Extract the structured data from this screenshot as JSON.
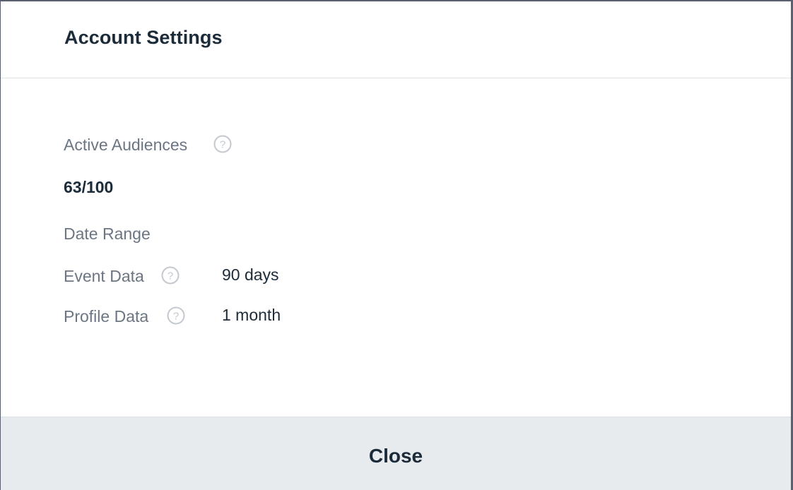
{
  "modal": {
    "title": "Account Settings"
  },
  "active_audiences": {
    "label": "Active Audiences",
    "value": "63/100",
    "icon": "help-circle-icon"
  },
  "date_range": {
    "heading": "Date Range",
    "rows": [
      {
        "label": "Event Data",
        "value": "90 days",
        "icon": "help-circle-icon"
      },
      {
        "label": "Profile Data",
        "value": "1 month",
        "icon": "help-circle-icon"
      }
    ]
  },
  "footer": {
    "close_label": "Close"
  },
  "colors": {
    "title_text": "#1c2b3a",
    "label_text": "#6c7683",
    "icon_stroke": "#c4c9cf",
    "footer_bg": "#e8ebee"
  }
}
